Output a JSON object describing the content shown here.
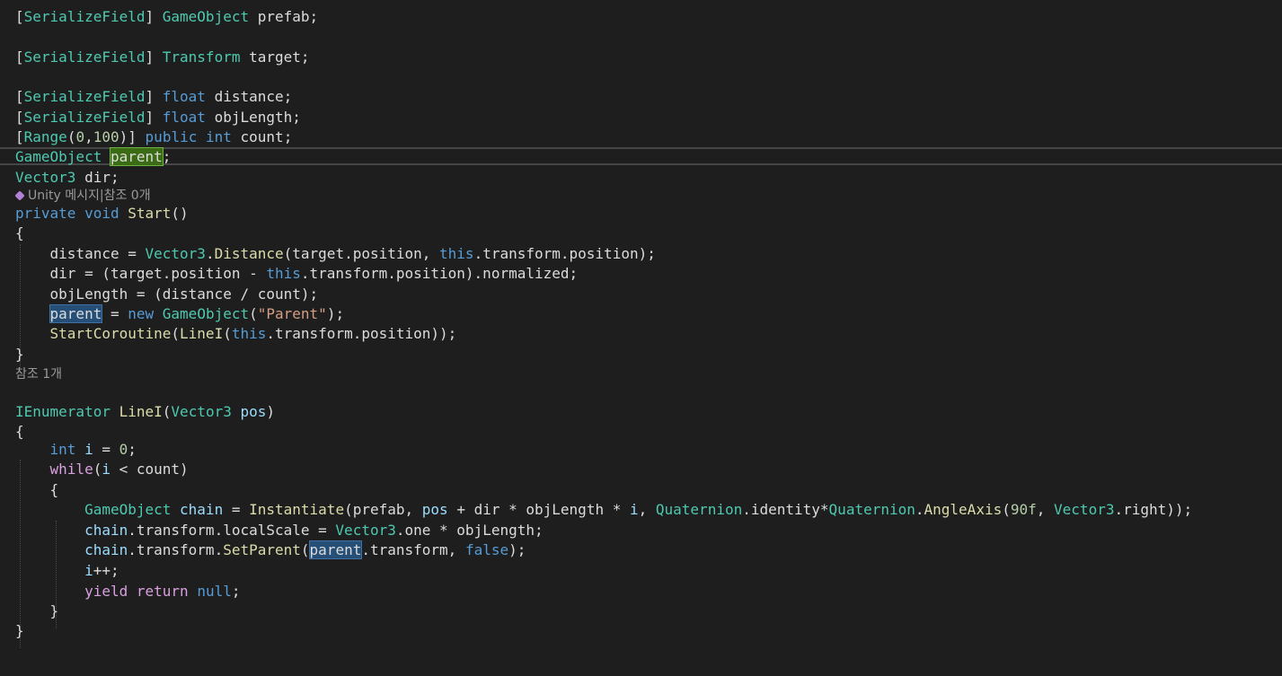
{
  "code_lines": [
    [
      {
        "t": "[",
        "c": "txt"
      },
      {
        "t": "SerializeField",
        "c": "type"
      },
      {
        "t": "] ",
        "c": "txt"
      },
      {
        "t": "GameObject",
        "c": "type"
      },
      {
        "t": " prefab;",
        "c": "txt"
      }
    ],
    [],
    [
      {
        "t": "[",
        "c": "txt"
      },
      {
        "t": "SerializeField",
        "c": "type"
      },
      {
        "t": "] ",
        "c": "txt"
      },
      {
        "t": "Transform",
        "c": "type"
      },
      {
        "t": " target;",
        "c": "txt"
      }
    ],
    [],
    [
      {
        "t": "[",
        "c": "txt"
      },
      {
        "t": "SerializeField",
        "c": "type"
      },
      {
        "t": "] ",
        "c": "txt"
      },
      {
        "t": "float",
        "c": "kw"
      },
      {
        "t": " distance;",
        "c": "txt"
      }
    ],
    [
      {
        "t": "[",
        "c": "txt"
      },
      {
        "t": "SerializeField",
        "c": "type"
      },
      {
        "t": "] ",
        "c": "txt"
      },
      {
        "t": "float",
        "c": "kw"
      },
      {
        "t": " objLength;",
        "c": "txt"
      }
    ],
    [
      {
        "t": "[",
        "c": "txt"
      },
      {
        "t": "Range",
        "c": "type"
      },
      {
        "t": "(",
        "c": "txt"
      },
      {
        "t": "0",
        "c": "num"
      },
      {
        "t": ",",
        "c": "txt"
      },
      {
        "t": "100",
        "c": "num"
      },
      {
        "t": ")] ",
        "c": "txt"
      },
      {
        "t": "public",
        "c": "kw"
      },
      {
        "t": " ",
        "c": "txt"
      },
      {
        "t": "int",
        "c": "kw"
      },
      {
        "t": " count;",
        "c": "txt"
      }
    ],
    [
      {
        "t": "GameObject",
        "c": "type"
      },
      {
        "t": " ",
        "c": "txt"
      },
      {
        "t": "parent",
        "c": "txt",
        "hl": "green"
      },
      {
        "t": ";",
        "c": "txt"
      }
    ],
    [
      {
        "t": "Vector3",
        "c": "type"
      },
      {
        "t": " dir;",
        "c": "txt"
      }
    ],
    [
      {
        "hint": "Unity 메시지|참조 0개",
        "icon": "unity-icon"
      }
    ],
    [
      {
        "t": "private",
        "c": "kw"
      },
      {
        "t": " ",
        "c": "txt"
      },
      {
        "t": "void",
        "c": "kw"
      },
      {
        "t": " ",
        "c": "txt"
      },
      {
        "t": "Start",
        "c": "fn"
      },
      {
        "t": "()",
        "c": "txt"
      }
    ],
    [
      {
        "t": "{",
        "c": "txt"
      }
    ],
    [
      {
        "t": "    distance = ",
        "c": "txt"
      },
      {
        "t": "Vector3",
        "c": "type"
      },
      {
        "t": ".",
        "c": "txt"
      },
      {
        "t": "Distance",
        "c": "fn"
      },
      {
        "t": "(target.position, ",
        "c": "txt"
      },
      {
        "t": "this",
        "c": "kw"
      },
      {
        "t": ".transform.position);",
        "c": "txt"
      }
    ],
    [
      {
        "t": "    dir = (target.position - ",
        "c": "txt"
      },
      {
        "t": "this",
        "c": "kw"
      },
      {
        "t": ".transform.position).normalized;",
        "c": "txt"
      }
    ],
    [
      {
        "t": "    objLength = (distance / count);",
        "c": "txt"
      }
    ],
    [],
    [
      {
        "t": "    ",
        "c": "txt"
      },
      {
        "t": "parent",
        "c": "txt",
        "hl": "blue"
      },
      {
        "t": " = ",
        "c": "txt"
      },
      {
        "t": "new",
        "c": "kw"
      },
      {
        "t": " ",
        "c": "txt"
      },
      {
        "t": "GameObject",
        "c": "type"
      },
      {
        "t": "(",
        "c": "txt"
      },
      {
        "t": "\"Parent\"",
        "c": "str"
      },
      {
        "t": ");",
        "c": "txt"
      }
    ],
    [
      {
        "t": "    ",
        "c": "txt"
      },
      {
        "t": "StartCoroutine",
        "c": "fn"
      },
      {
        "t": "(",
        "c": "txt"
      },
      {
        "t": "LineI",
        "c": "fn"
      },
      {
        "t": "(",
        "c": "txt"
      },
      {
        "t": "this",
        "c": "kw"
      },
      {
        "t": ".transform.position));",
        "c": "txt"
      }
    ],
    [
      {
        "t": "}",
        "c": "txt"
      }
    ],
    [],
    [
      {
        "hint": "참조 1개"
      }
    ],
    [
      {
        "t": "IEnumerator",
        "c": "type"
      },
      {
        "t": " ",
        "c": "txt"
      },
      {
        "t": "LineI",
        "c": "fn"
      },
      {
        "t": "(",
        "c": "txt"
      },
      {
        "t": "Vector3",
        "c": "type"
      },
      {
        "t": " ",
        "c": "txt"
      },
      {
        "t": "pos",
        "c": "var"
      },
      {
        "t": ")",
        "c": "txt"
      }
    ],
    [
      {
        "t": "{",
        "c": "txt"
      }
    ],
    [
      {
        "t": "    ",
        "c": "txt"
      },
      {
        "t": "int",
        "c": "kw"
      },
      {
        "t": " ",
        "c": "txt"
      },
      {
        "t": "i",
        "c": "var"
      },
      {
        "t": " = ",
        "c": "txt"
      },
      {
        "t": "0",
        "c": "num"
      },
      {
        "t": ";",
        "c": "txt"
      }
    ],
    [
      {
        "t": "    ",
        "c": "txt"
      },
      {
        "t": "while",
        "c": "ctl"
      },
      {
        "t": "(",
        "c": "txt"
      },
      {
        "t": "i",
        "c": "var"
      },
      {
        "t": " < count)",
        "c": "txt"
      }
    ],
    [
      {
        "t": "    {",
        "c": "txt"
      }
    ],
    [
      {
        "t": "        ",
        "c": "txt"
      },
      {
        "t": "GameObject",
        "c": "type"
      },
      {
        "t": " ",
        "c": "txt"
      },
      {
        "t": "chain",
        "c": "var"
      },
      {
        "t": " = ",
        "c": "txt"
      },
      {
        "t": "Instantiate",
        "c": "fn"
      },
      {
        "t": "(prefab, ",
        "c": "txt"
      },
      {
        "t": "pos",
        "c": "var"
      },
      {
        "t": " + dir * objLength * ",
        "c": "txt"
      },
      {
        "t": "i",
        "c": "var"
      },
      {
        "t": ", ",
        "c": "txt"
      },
      {
        "t": "Quaternion",
        "c": "type"
      },
      {
        "t": ".identity*",
        "c": "txt"
      },
      {
        "t": "Quaternion",
        "c": "type"
      },
      {
        "t": ".",
        "c": "txt"
      },
      {
        "t": "AngleAxis",
        "c": "fn"
      },
      {
        "t": "(",
        "c": "txt"
      },
      {
        "t": "90f",
        "c": "num"
      },
      {
        "t": ", ",
        "c": "txt"
      },
      {
        "t": "Vector3",
        "c": "type"
      },
      {
        "t": ".right));",
        "c": "txt"
      }
    ],
    [
      {
        "t": "        ",
        "c": "txt"
      },
      {
        "t": "chain",
        "c": "var"
      },
      {
        "t": ".transform.localScale = ",
        "c": "txt"
      },
      {
        "t": "Vector3",
        "c": "type"
      },
      {
        "t": ".one * objLength;",
        "c": "txt"
      }
    ],
    [
      {
        "t": "        ",
        "c": "txt"
      },
      {
        "t": "chain",
        "c": "var"
      },
      {
        "t": ".transform.",
        "c": "txt"
      },
      {
        "t": "SetParent",
        "c": "fn"
      },
      {
        "t": "(",
        "c": "txt"
      },
      {
        "t": "parent",
        "c": "txt",
        "hl": "blue"
      },
      {
        "t": ".transform, ",
        "c": "txt"
      },
      {
        "t": "false",
        "c": "kw"
      },
      {
        "t": ");",
        "c": "txt"
      }
    ],
    [
      {
        "t": "        ",
        "c": "txt"
      },
      {
        "t": "i",
        "c": "var"
      },
      {
        "t": "++;",
        "c": "txt"
      }
    ],
    [
      {
        "t": "        ",
        "c": "txt"
      },
      {
        "t": "yield",
        "c": "ctl"
      },
      {
        "t": " ",
        "c": "txt"
      },
      {
        "t": "return",
        "c": "ctl"
      },
      {
        "t": " ",
        "c": "txt"
      },
      {
        "t": "null",
        "c": "kw"
      },
      {
        "t": ";",
        "c": "txt"
      }
    ],
    [
      {
        "t": "    }",
        "c": "txt"
      }
    ],
    [
      {
        "t": "}",
        "c": "txt"
      }
    ]
  ],
  "colors": {
    "background": "#1e1e1e",
    "text": "#dcdcdc",
    "type": "#4ec9b0",
    "keyword": "#569cd6",
    "control": "#d8a0df",
    "function": "#dcdcaa",
    "variable": "#9cdcfe",
    "number": "#b5cea8",
    "string": "#d69d85",
    "highlight_definition": "#3b6b14",
    "highlight_reference": "#264f78"
  }
}
